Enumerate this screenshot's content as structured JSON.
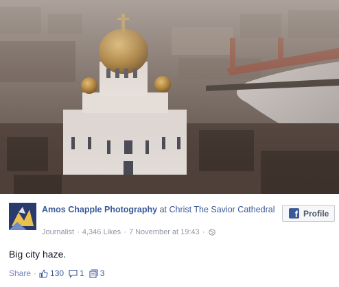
{
  "post": {
    "page_name": "Amos Chapple Photography",
    "at_word": "at",
    "place": "Christ The Savior Cathedral",
    "category": "Journalist",
    "likes_text": "4,346 Likes",
    "date": "7 November at 19:43",
    "separator": "·",
    "message": "Big city haze.",
    "profile_button": "Profile"
  },
  "actions": {
    "share": "Share",
    "likes": "130",
    "comments": "1",
    "shares": "3"
  },
  "icons": {
    "profile_button_icon": "facebook-logo-icon",
    "privacy": "globe-icon",
    "like": "thumbs-up-icon",
    "comment": "comment-bubble-icon",
    "share_count": "share-stack-icon"
  },
  "colors": {
    "link": "#3b5998",
    "muted": "#9197a3",
    "action": "#6d84b4"
  }
}
